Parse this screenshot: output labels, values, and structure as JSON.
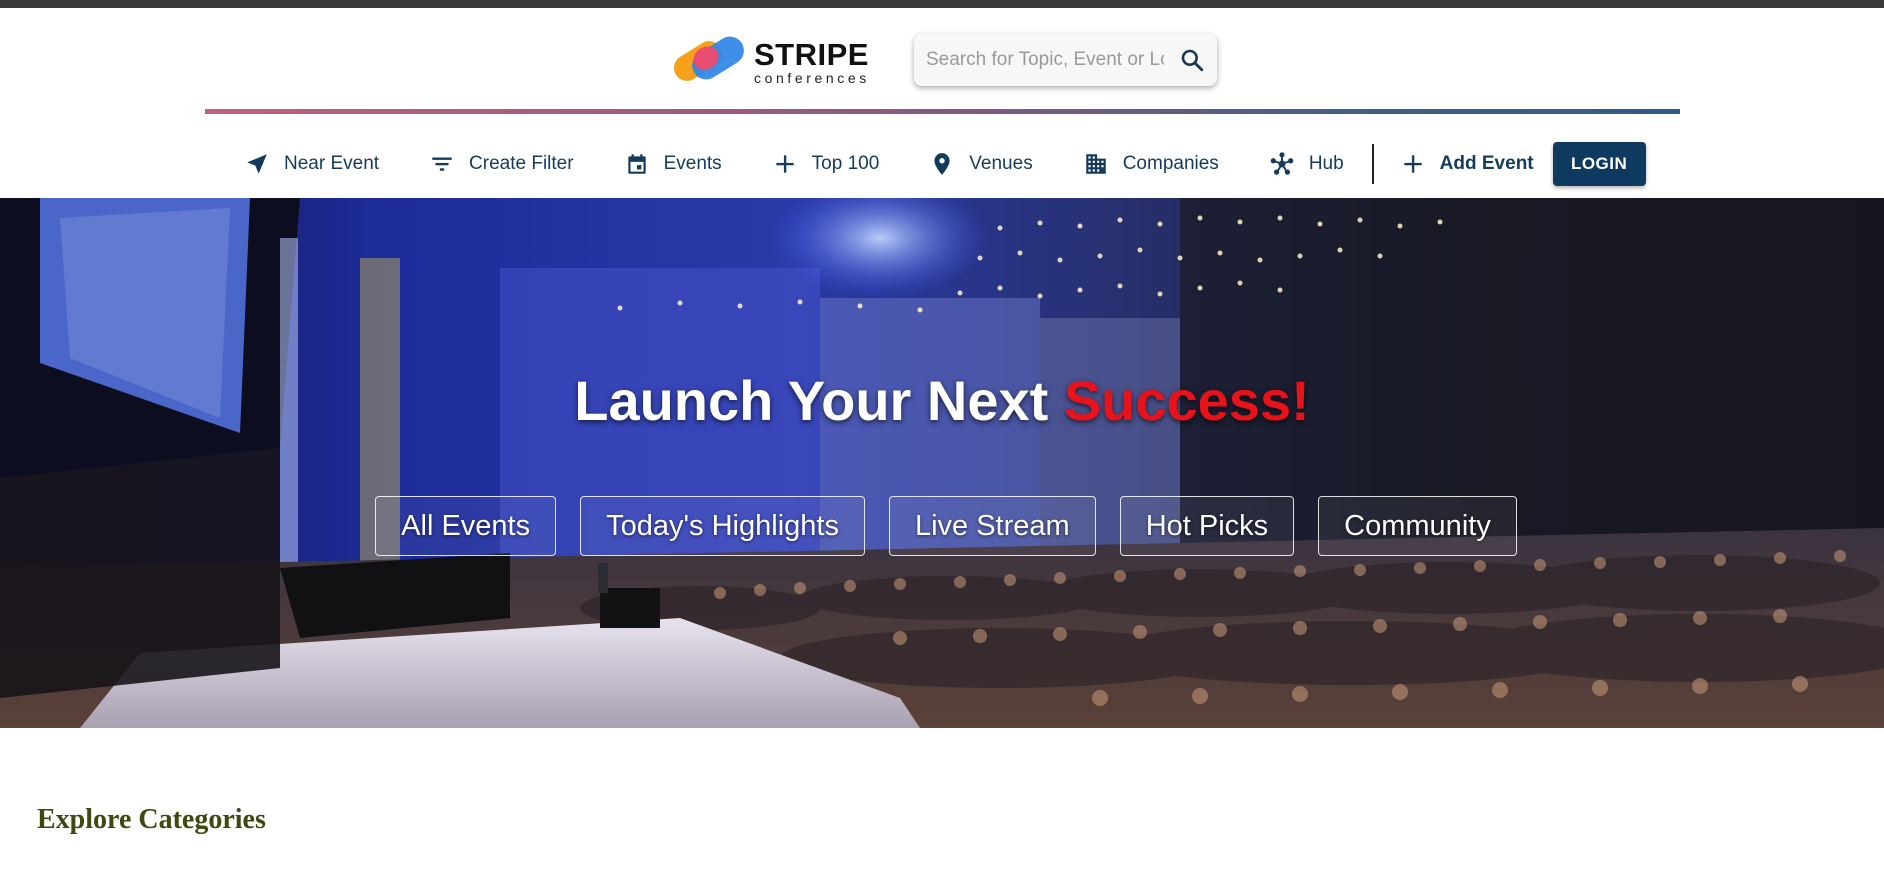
{
  "brand": {
    "name": "STRIPE",
    "tagline": "conferences",
    "colors": {
      "orange": "#f7a11a",
      "pink": "#f04a6b",
      "blue": "#2f86e6"
    }
  },
  "search": {
    "placeholder": "Search for Topic, Event or Location",
    "icon": "search-icon"
  },
  "nav": {
    "items": [
      {
        "label": "Near Event",
        "icon": "navigation-arrow-icon"
      },
      {
        "label": "Create Filter",
        "icon": "filter-icon"
      },
      {
        "label": "Events",
        "icon": "calendar-icon"
      },
      {
        "label": "Top 100",
        "icon": "plus-icon"
      },
      {
        "label": "Venues",
        "icon": "location-pin-icon"
      },
      {
        "label": "Companies",
        "icon": "building-icon"
      },
      {
        "label": "Hub",
        "icon": "hub-icon"
      }
    ],
    "add_event": {
      "label": "Add Event",
      "icon": "plus-icon"
    },
    "login_label": "LOGIN"
  },
  "hero": {
    "title_main": "Launch Your Next ",
    "title_accent": "Success!",
    "accent_color": "#e8121b",
    "pills": [
      "All Events",
      "Today's Highlights",
      "Live Stream",
      "Hot Picks",
      "Community"
    ]
  },
  "sections": {
    "explore_title": "Explore Categories"
  }
}
